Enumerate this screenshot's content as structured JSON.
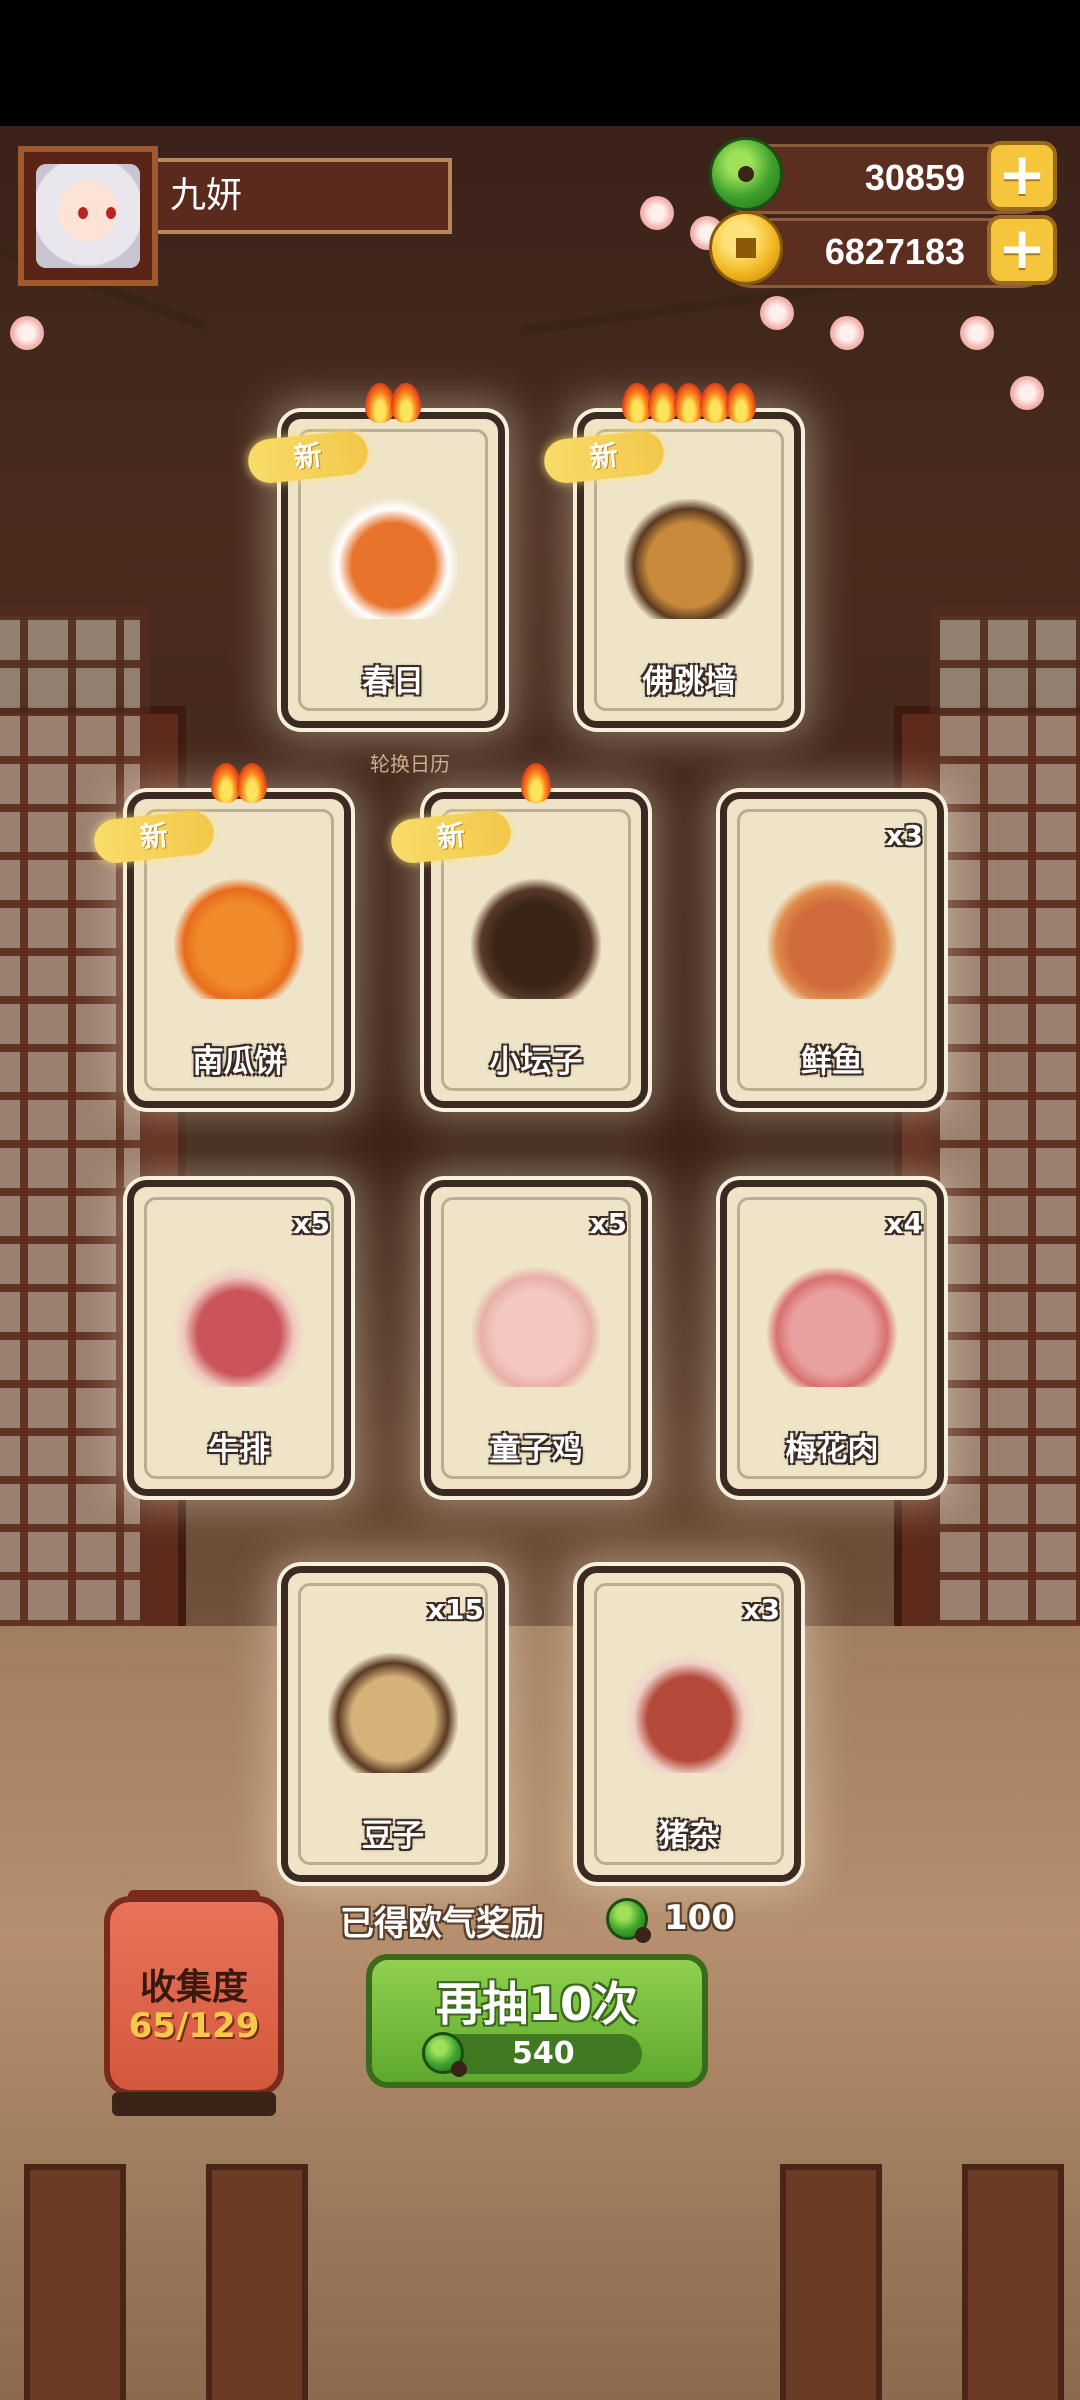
{
  "player": {
    "name": "九妍"
  },
  "currencies": {
    "jade": {
      "value": "30859",
      "icon": "jade-icon"
    },
    "coins": {
      "value": "6827183",
      "icon": "coin-icon"
    },
    "plus_label": "+"
  },
  "hint": "轮换日历",
  "new_label": "新",
  "cards": [
    {
      "label": "春日",
      "count": "",
      "flames": 2,
      "is_new": true
    },
    {
      "label": "佛跳墙",
      "count": "",
      "flames": 5,
      "is_new": true
    },
    {
      "label": "南瓜饼",
      "count": "",
      "flames": 2,
      "is_new": true
    },
    {
      "label": "小坛子",
      "count": "",
      "flames": 1,
      "is_new": true
    },
    {
      "label": "鲜鱼",
      "count": "x3",
      "flames": 0,
      "is_new": false
    },
    {
      "label": "牛排",
      "count": "x5",
      "flames": 0,
      "is_new": false
    },
    {
      "label": "童子鸡",
      "count": "x5",
      "flames": 0,
      "is_new": false
    },
    {
      "label": "梅花肉",
      "count": "x4",
      "flames": 0,
      "is_new": false
    },
    {
      "label": "豆子",
      "count": "x15",
      "flames": 0,
      "is_new": false
    },
    {
      "label": "猪杂",
      "count": "x3",
      "flames": 0,
      "is_new": false
    }
  ],
  "reward": {
    "text": "已得欧气奖励",
    "amount": "100"
  },
  "draw_button": {
    "label": "再抽10次",
    "cost": "540"
  },
  "collection": {
    "label": "收集度",
    "progress": "65/129"
  }
}
